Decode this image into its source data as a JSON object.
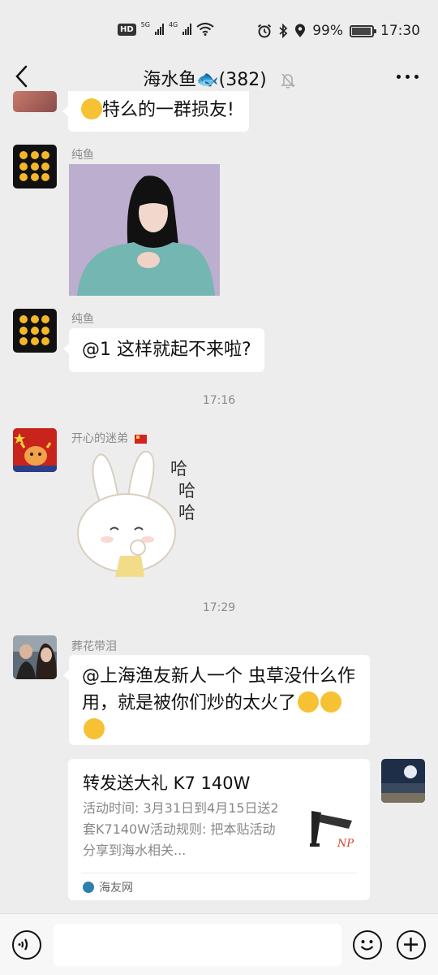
{
  "status_bar": {
    "hd": "HD",
    "net1": "5G",
    "net2": "4G",
    "battery": "99%",
    "time": "17:30"
  },
  "chat": {
    "title": "海水鱼🐟(382)",
    "icons": {
      "back": "back-arrow-icon",
      "mute": "bell-muted-icon",
      "more": "more-dots-icon"
    }
  },
  "messages": [
    {
      "text": "特么的一群损友!"
    },
    {
      "sender": "纯鱼",
      "type": "image"
    },
    {
      "sender": "纯鱼",
      "text": "@1  这样就起不来啦?"
    },
    {
      "time": "17:16"
    },
    {
      "sender": "开心的迷弟",
      "type": "sticker",
      "sticker_text": [
        "哈",
        "哈",
        "哈"
      ]
    },
    {
      "time": "17:29"
    },
    {
      "sender": "葬花带泪",
      "text": "@上海渔友新人一个  虫草没什么作用，就是被你们炒的太火了"
    }
  ],
  "link_card": {
    "title": "转发送大礼 K7 140W",
    "description": "活动时间: 3月31日到4月15日送2套K7140W活动规则: 把本贴活动分享到海水相关...",
    "source": "海友网",
    "thumb_text": "NP"
  },
  "input_bar": {
    "icons": {
      "voice": "voice-icon",
      "emoji": "emoji-icon",
      "plus": "plus-icon"
    }
  },
  "colors": {
    "background": "#ededed",
    "bubble": "#ffffff",
    "meta_text": "#8a8a8a"
  }
}
